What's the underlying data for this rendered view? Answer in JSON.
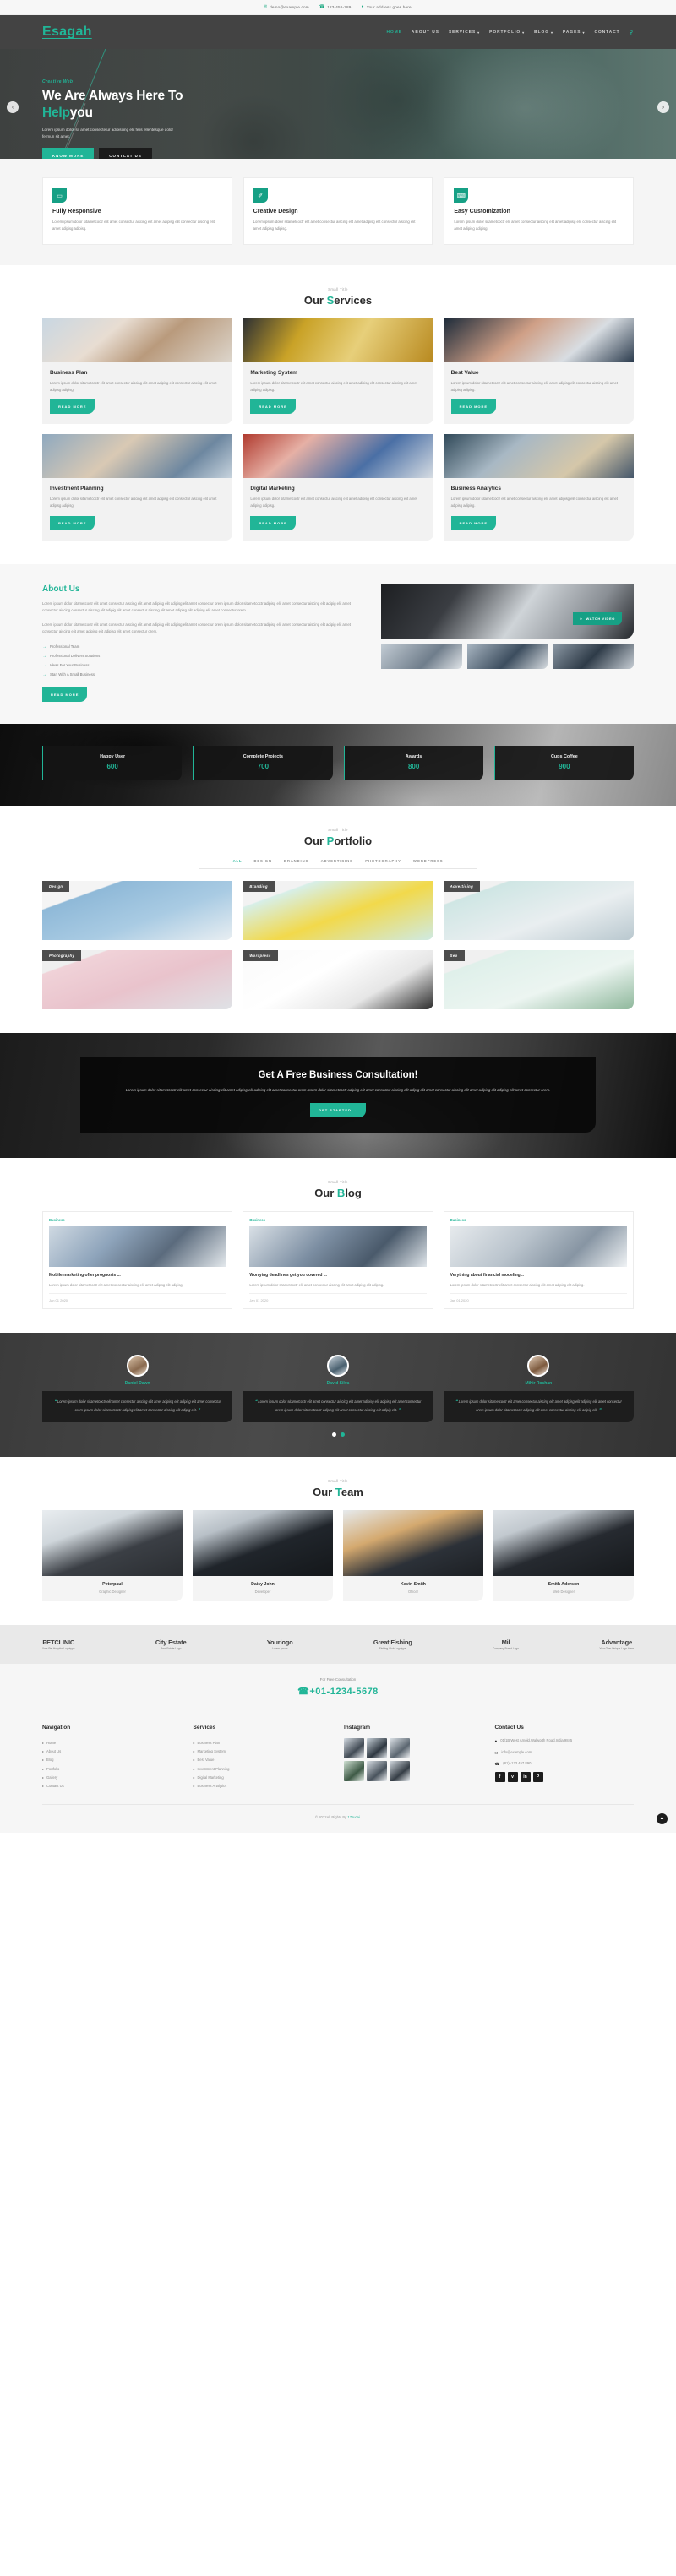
{
  "topbar": {
    "email": "demo@example.com",
    "phone": "123-456-789",
    "address": "Your address goes here.",
    "email_icon": "envelope-icon",
    "phone_icon": "phone-icon",
    "location_icon": "map-pin-icon"
  },
  "header": {
    "logo": "Esagah",
    "nav": [
      {
        "label": "HOME",
        "caret": "",
        "active": true
      },
      {
        "label": "ABOUT US",
        "caret": "",
        "active": false
      },
      {
        "label": "SERVICES",
        "caret": "▾",
        "active": false
      },
      {
        "label": "PORTFOLIO",
        "caret": "▾",
        "active": false
      },
      {
        "label": "BLOG",
        "caret": "▾",
        "active": false
      },
      {
        "label": "PAGES",
        "caret": "▾",
        "active": false
      },
      {
        "label": "CONTACT",
        "caret": "",
        "active": false
      }
    ],
    "search_icon": "search-icon"
  },
  "hero": {
    "small": "Creative Web",
    "title_line1": "We Are Always Here To",
    "title_accent": "Help",
    "title_rest": "you",
    "paragraph": "Lorem ipsum dolor sit amet consectetur adipiscing elit felis ellentesque dolor fermun sit amet.",
    "btn_primary": "KNOW MORE",
    "btn_secondary": "CONTCAT US",
    "arrow_left": "‹",
    "arrow_right": "›"
  },
  "features": [
    {
      "icon": "monitor-icon",
      "glyph": "▭",
      "title": "Fully Responsive",
      "text": "Lorem ipsum dolor sitametcoctr elit amet consectur aiscing elit amet adipisg elit consectur aiscing elit amet adipisg adipisg."
    },
    {
      "icon": "pencil-icon",
      "glyph": "✐",
      "title": "Creative Design",
      "text": "Lorem ipsum dolor sitametcoctr elit amet consectur aiscing elit amet adipisg elit consectur aiscing elit amet adipisg adipisg."
    },
    {
      "icon": "laptop-icon",
      "glyph": "⌨",
      "title": "Easy Customization",
      "text": "Lorem ipsum dolor sitametcoctr elit amet consectur aiscing elit amet adipisg elit consectur aiscing elit amet adipisg adipisg."
    }
  ],
  "services": {
    "small_title": "Small Title",
    "title_prefix": "Our ",
    "title_accent": "S",
    "title_suffix": "ervices",
    "items": [
      {
        "title": "Business Plan",
        "text": "Lorem ipsum dolor sitametcoctr elit amet consectur aiscing elit amet adipisg elit consectur aiscing elit amet adipisg adipisg.",
        "btn": "READ MORE"
      },
      {
        "title": "Marketing System",
        "text": "Lorem ipsum dolor sitametcoctr elit amet consectur aiscing elit amet adipisg elit consectur aiscing elit amet adipisg adipisg.",
        "btn": "READ MORE"
      },
      {
        "title": "Best Value",
        "text": "Lorem ipsum dolor sitametcoctr elit amet consectur aiscing elit amet adipisg elit consectur aiscing elit amet adipisg adipisg.",
        "btn": "READ MORE"
      },
      {
        "title": "Investment Planning",
        "text": "Lorem ipsum dolor sitametcoctr elit amet consectur aiscing elit amet adipisg elit consectur aiscing elit amet adipisg adipisg.",
        "btn": "READ MORE"
      },
      {
        "title": "Digital Marketing",
        "text": "Lorem ipsum dolor sitametcoctr elit amet consectur aiscing elit amet adipisg elit consectur aiscing elit amet adipisg adipisg.",
        "btn": "READ MORE"
      },
      {
        "title": "Business Analytics",
        "text": "Lorem ipsum dolor sitametcoctr elit amet consectur aiscing elit amet adipisg elit consectur aiscing elit amet adipisg adipisg.",
        "btn": "READ MORE"
      }
    ]
  },
  "about": {
    "title": "About Us",
    "p1": "Lorem ipsum dolor sitametcoctr elit amet consectur aiscing elit amet adipisg elit adipisg elit amet consectur orem ipsum dolor sitametcoctr adipisg elit amet consectur aiscing elit adipig elit amet consectur aiscing consectur aiscing elit adipig elit amet consectur aiscing elit amet adipisg elit adipisg elit amet consectur orem.",
    "p2": "Lorem ipsum dolor sitametcoctr elit amet consectur aiscing elit amet adipisg elit adipisg elit amet consectur orem ipsum dolor sitametcoctr adipisg elit amet consectur aiscing elit adipig elit amet consectur aiscing elit amet adipisg elit adipisg elit amet consectur orem.",
    "list": [
      "Professional Team",
      "Professional Delivers Solutions",
      "Ideas For Your Business",
      "Start With A Small Business"
    ],
    "btn": "READ MORE",
    "watch_btn": "WATCH VIDEO",
    "watch_icon": "play-icon"
  },
  "counters": [
    {
      "label": "Happy User",
      "value": "600"
    },
    {
      "label": "Complete Projects",
      "value": "700"
    },
    {
      "label": "Awards",
      "value": "800"
    },
    {
      "label": "Cups Coffee",
      "value": "900"
    }
  ],
  "portfolio": {
    "small_title": "Small Title",
    "title_prefix": "Our ",
    "title_accent": "P",
    "title_suffix": "ortfolio",
    "filters": [
      {
        "label": "ALL",
        "active": true
      },
      {
        "label": "DESIGN",
        "active": false
      },
      {
        "label": "BRANDING",
        "active": false
      },
      {
        "label": "ADVERTISING",
        "active": false
      },
      {
        "label": "PHOTOGRAPHY",
        "active": false
      },
      {
        "label": "WORDPRESS",
        "active": false
      }
    ],
    "items": [
      {
        "tag": "Design"
      },
      {
        "tag": "Branding"
      },
      {
        "tag": "Advertising"
      },
      {
        "tag": "Photography"
      },
      {
        "tag": "Wordpress"
      },
      {
        "tag": "Seo"
      }
    ]
  },
  "consult": {
    "title": "Get A Free Business Consultation!",
    "text": "Lorem ipsum dolor sitametcoctr elit amet consectur aiscing elit amet adipisg elit adipisg elit amet consectur orem ipsum dolor sitametcoctr adipisg elit amet consectur aiscing elit adipig elit amet consectur aiscing elit amet adipisg elit adipisg elit amet consectur orem.",
    "btn": "GET STARTED →"
  },
  "blog": {
    "small_title": "Small Title",
    "title_prefix": "Our ",
    "title_accent": "B",
    "title_suffix": "log",
    "posts": [
      {
        "cat": "Business",
        "title": "Mobile marketing offer prognosis ...",
        "text": "Lorem ipsum dolor sitametcoctr elit amet consectur aiscing elit amet adipisg elit adipisg.",
        "date": "Jan 01 2020"
      },
      {
        "cat": "Business",
        "title": "Worrying deadlines get you covered ...",
        "text": "Lorem ipsum dolor sitametcoctr elit amet consectur aiscing elit amet adipisg elit adipisg.",
        "date": "Jan 01 2020"
      },
      {
        "cat": "Business",
        "title": "Verything about financial modeling...",
        "text": "Lorem ipsum dolor sitametcoctr elit amet consectur aiscing elit amet adipisg elit adipisg.",
        "date": "Jan 01 2020"
      }
    ]
  },
  "testimonials": {
    "items": [
      {
        "name": "Daniel Dawn",
        "quote": "Lorem ipsum dolor sitametcoctr elit amet consectur aiscing elit amet adipisg elit adipisg elit amet consectur orem ipsum dolor sitametcoctr adipisg elit amet consectur aiscing elit adipig elit."
      },
      {
        "name": "David Silva",
        "quote": "Lorem ipsum dolor sitametcoctr elit amet consectur aiscing elit amet adipisg elit adipisg elit amet consectur orem ipsum dolor sitametcoctr adipisg elit amet consectur aiscing elit adipig elit."
      },
      {
        "name": "Mihir Roshan",
        "quote": "Lorem ipsum dolor sitametcoctr elit amet consectur aiscing elit amet adipisg elit adipisg elit amet consectur orem ipsum dolor sitametcoctr adipisg elit amet consectur aiscing elit adipig elit."
      }
    ],
    "quote_open": "❝",
    "quote_close": "❞"
  },
  "team": {
    "small_title": "Small Title",
    "title_prefix": "Our ",
    "title_accent": "T",
    "title_suffix": "eam",
    "members": [
      {
        "name": "Peterpaul",
        "role": "Graphic Designer"
      },
      {
        "name": "Daisy John",
        "role": "Developer"
      },
      {
        "name": "Kevin Smith",
        "role": "Officer"
      },
      {
        "name": "Smith Aderson",
        "role": "Web Designer"
      }
    ]
  },
  "clients": [
    {
      "name": "PETCLINIC",
      "sub": "Your Pet Hospital Logotype"
    },
    {
      "name": "City Estate",
      "sub": "Real Estate Logo"
    },
    {
      "name": "Yourlogo",
      "sub": "Lorem Ipsum"
    },
    {
      "name": "Great Fishing",
      "sub": "Fishing Club Logotype"
    },
    {
      "name": "Mil",
      "sub": "Company Brand Logo"
    },
    {
      "name": "Advantage",
      "sub": "Your Own Unique Logo Here"
    }
  ],
  "phone_bar": {
    "label": "For Free Consultation",
    "number": "+01-1234-5678",
    "icon": "phone-icon"
  },
  "footer": {
    "navigation": {
      "title": "Navigation",
      "items": [
        "Home",
        "About Us",
        "Blog",
        "Portfolio",
        "Gallery",
        "Contact Us"
      ]
    },
    "services": {
      "title": "Services",
      "items": [
        "Business Plan",
        "Marketing System",
        "Best Value",
        "Investment Planning",
        "Digital Marketing",
        "Business Analytics"
      ]
    },
    "instagram": {
      "title": "Instagram"
    },
    "contact": {
      "title": "Contact Us",
      "address": "01/1B,West Arnold,Walworth Road,India,9845",
      "email": "info@example.com",
      "phone": "(81)+123 457 890",
      "address_icon": "map-pin-icon",
      "email_icon": "envelope-icon",
      "phone_icon": "phone-icon",
      "socials": [
        "f",
        "ᴠ",
        "in",
        "P"
      ]
    },
    "copyright_pre": "© 2022All Rights By ",
    "copyright_link": "17sucai",
    "copyright_post": ".",
    "to_top_icon": "chevron-up-icon"
  },
  "colors": {
    "accent": "#21b597",
    "accent_dark": "#16a085",
    "header_bg": "#434343",
    "dark": "#1d1d1d"
  }
}
